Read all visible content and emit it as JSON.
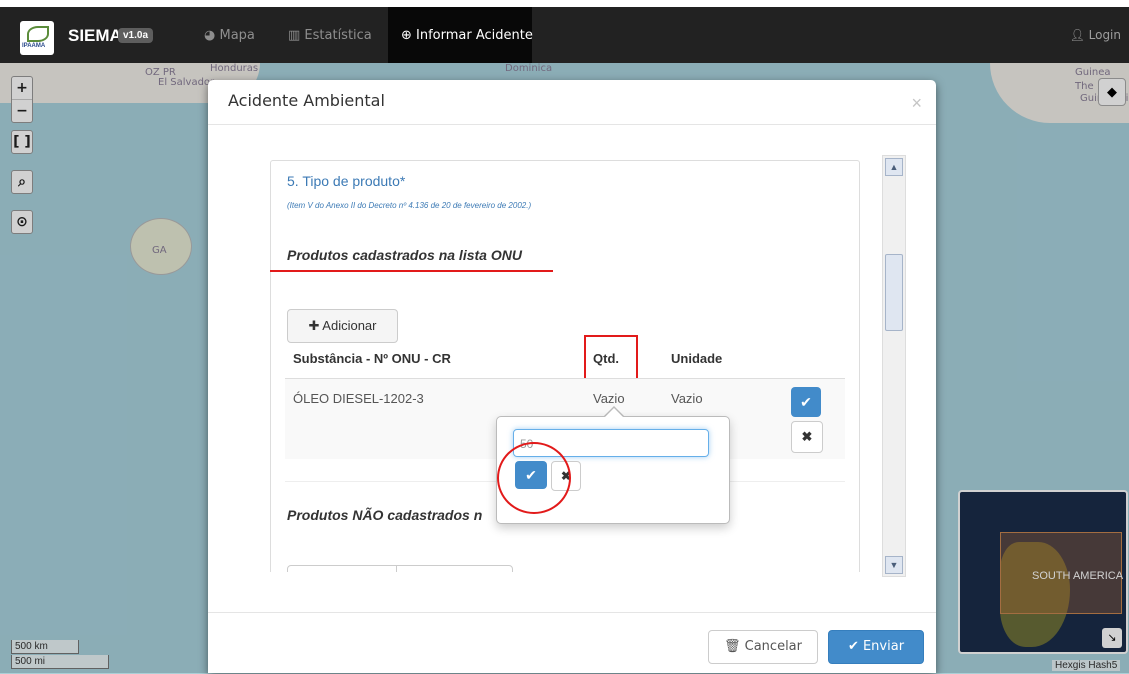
{
  "navbar": {
    "brand": "SIEMA",
    "version": "v1.0a",
    "logo_text": "IPAAMA",
    "items": [
      {
        "label": "Mapa",
        "icon": "globe-icon"
      },
      {
        "label": "Estatística",
        "icon": "bar-chart-icon"
      },
      {
        "label": "Informar Acidente",
        "icon": "plus-circle-icon",
        "active": true
      }
    ],
    "login": "Login"
  },
  "map": {
    "labels": [
      "OZ PR",
      "Honduras",
      "El Salvador",
      "Dominica",
      "GA",
      "Guinea",
      "The",
      "Guinée-Bi"
    ],
    "scale_km": "500 km",
    "scale_mi": "500 mi",
    "attribution": "Hexgis Hash5",
    "minimap_label": "SOUTH AMERICA",
    "controls": [
      "+",
      "−",
      "⛶",
      "🔍",
      "⊙"
    ]
  },
  "modal": {
    "title": "Acidente Ambiental",
    "close": "×",
    "section_title": "5. Tipo de produto*",
    "section_note": "(Item V do Anexo II do Decreto nº 4.136 de 20 de fevereiro de 2002.)",
    "onu_heading": "Produtos cadastrados na lista ONU",
    "add_button": "Adicionar",
    "table": {
      "headers": [
        "Substância - Nº ONU - CR",
        "Qtd.",
        "Unidade"
      ],
      "rows": [
        {
          "substance": "ÓLEO DIESEL-1202-3",
          "qty": "Vazio",
          "unit": "Vazio"
        }
      ]
    },
    "non_onu_heading": "Produtos NÃO cadastrados n",
    "popover": {
      "input_value": "50"
    },
    "footer": {
      "cancel": "Cancelar",
      "send": "Enviar"
    }
  },
  "colors": {
    "primary": "#428bca",
    "highlight": "#e21a1a",
    "section": "#3c7ab5"
  }
}
